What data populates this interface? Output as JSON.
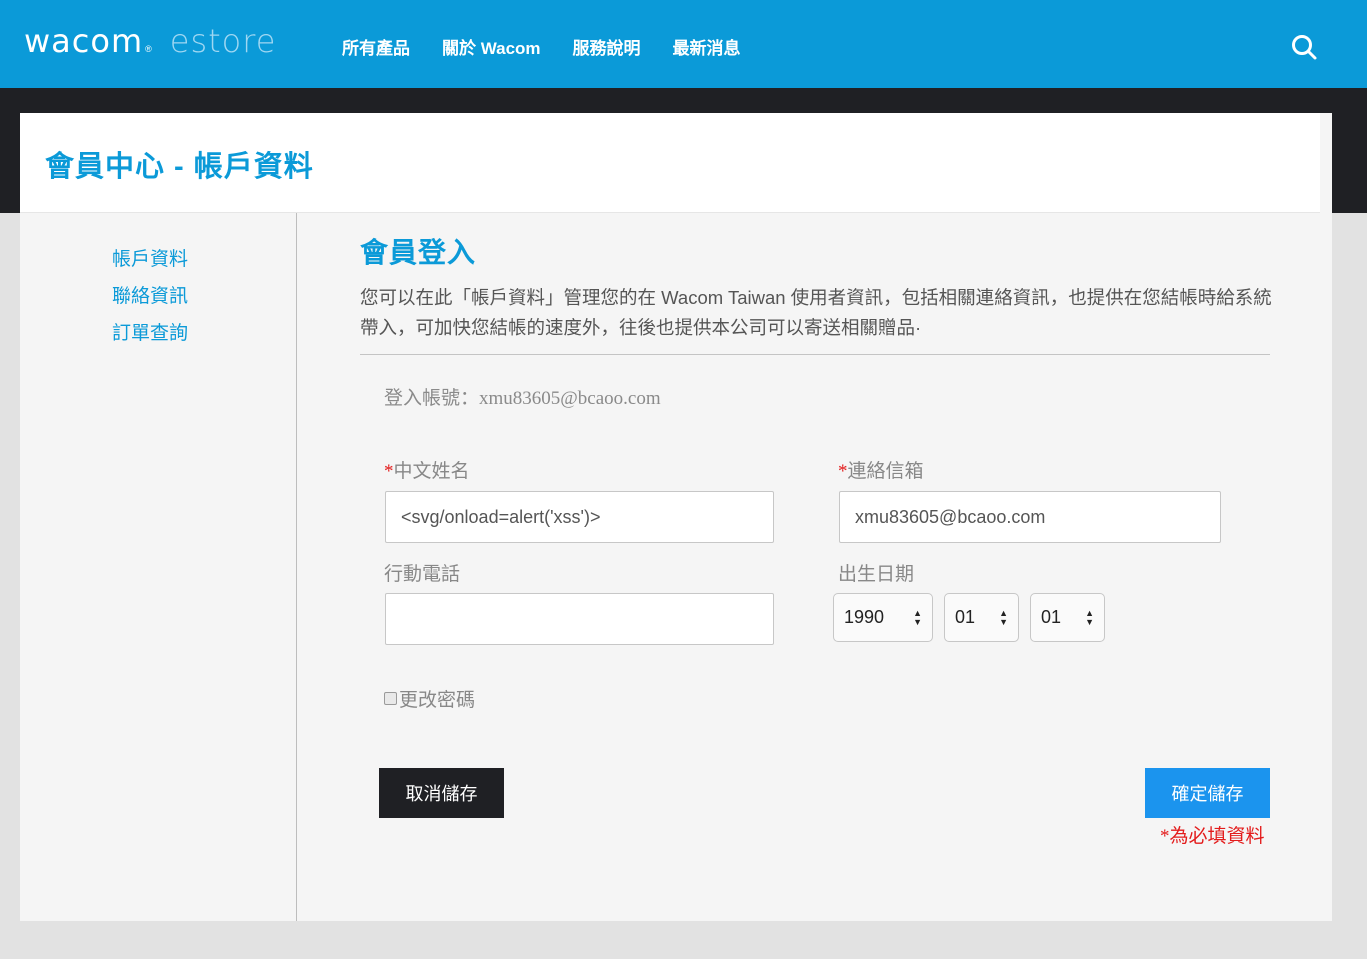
{
  "header": {
    "logo_wacom": "wacom",
    "logo_reg": "®",
    "logo_estore": "estore",
    "nav": [
      "所有產品",
      "關於 Wacom",
      "服務說明",
      "最新消息"
    ],
    "search_icon": "search-icon"
  },
  "page": {
    "title": "會員中心 - 帳戶資料"
  },
  "sidebar": {
    "items": [
      "帳戶資料",
      "聯絡資訊",
      "訂單查詢"
    ]
  },
  "content": {
    "title": "會員登入",
    "intro": "您可以在此「帳戶資料」管理您的在 Wacom Taiwan 使用者資訊，包括相關連絡資訊，也提供在您結帳時給系統帶入，可加快您結帳的速度外，往後也提供本公司可以寄送相關贈品·",
    "login_account": "登入帳號：xmu83605@bcaoo.com"
  },
  "form": {
    "required_mark": "*",
    "name_label": "中文姓名",
    "name_value": "<svg/onload=alert('xss')>",
    "email_label": "連絡信箱",
    "email_value": "xmu83605@bcaoo.com",
    "phone_label": "行動電話",
    "phone_value": "",
    "birthday_label": "出生日期",
    "birth_year": "1990",
    "birth_month": "01",
    "birth_day": "01",
    "change_password_label": "更改密碼"
  },
  "buttons": {
    "cancel": "取消儲存",
    "save": "確定儲存"
  },
  "required_note": "*為必填資料",
  "colors": {
    "brand_blue": "#0b9ad8",
    "save_blue": "#1b94ee",
    "dark": "#1f2024",
    "required_red": "#e31b1b"
  }
}
